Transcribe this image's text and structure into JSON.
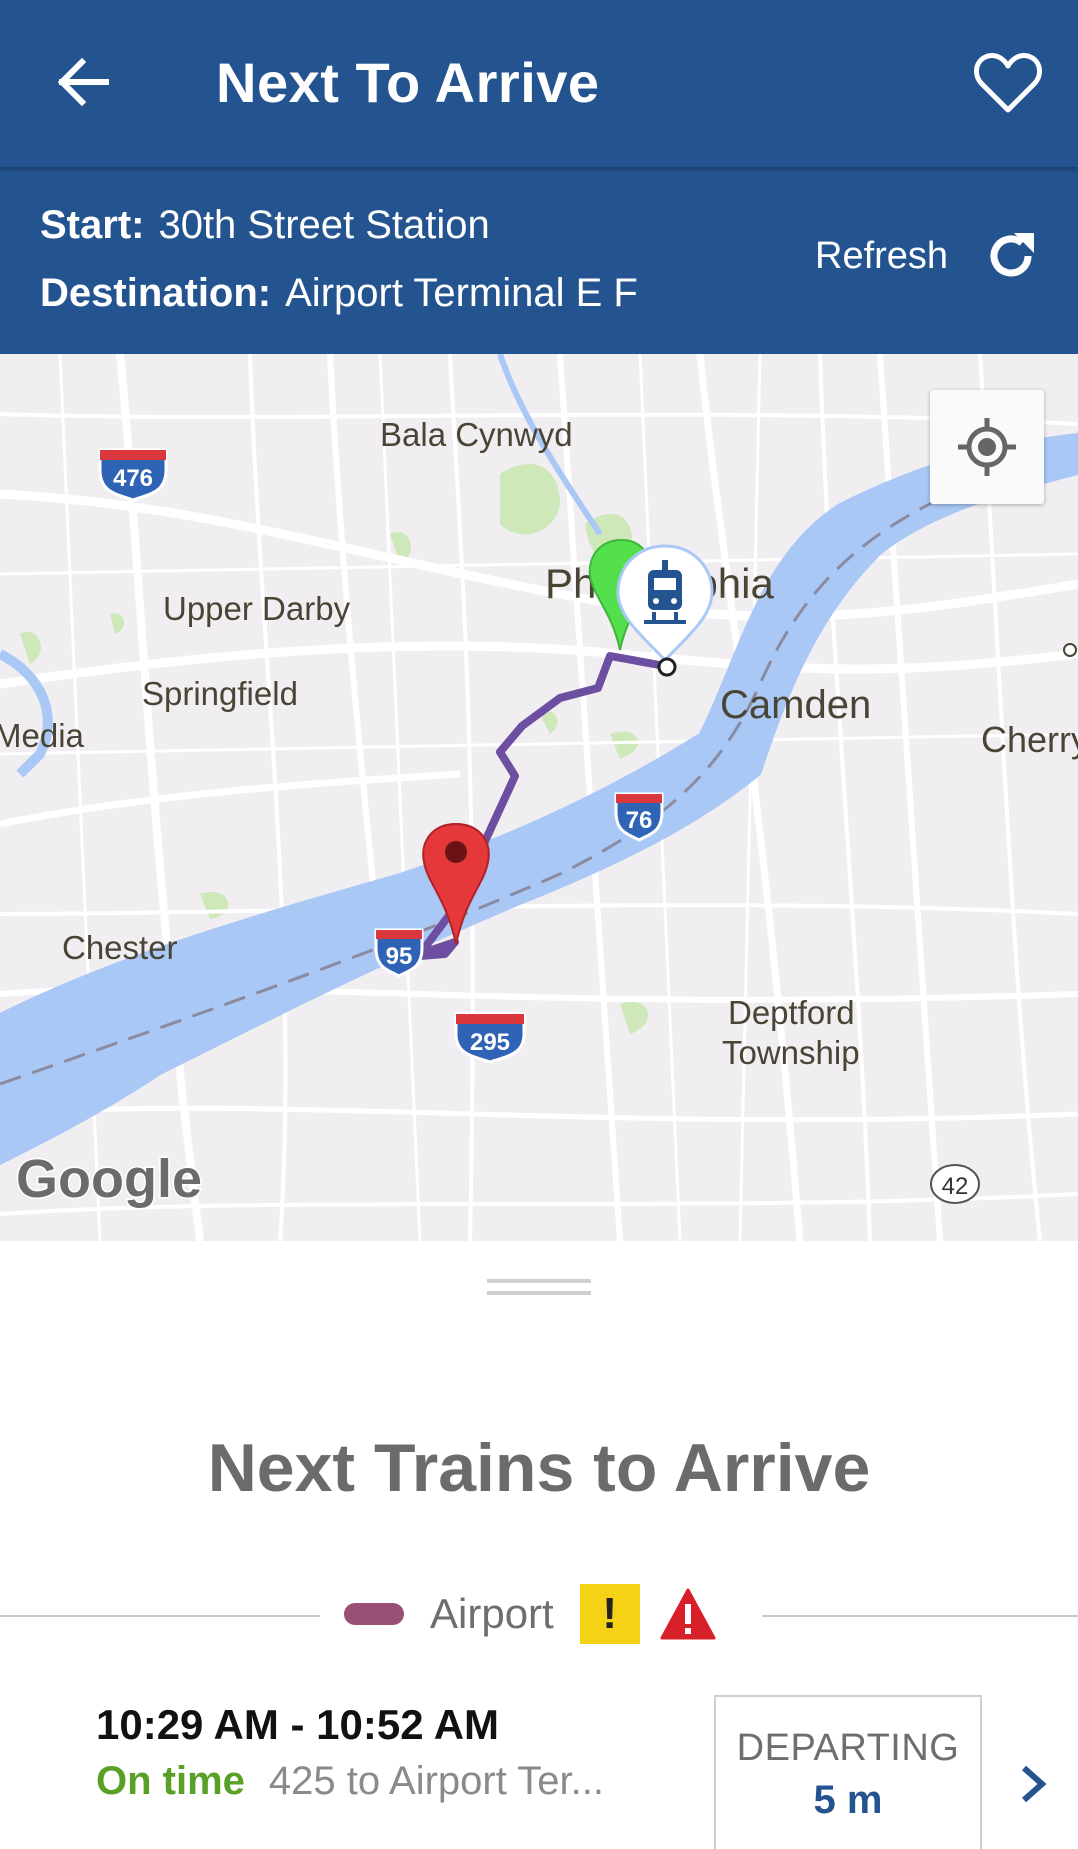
{
  "header": {
    "title": "Next To Arrive"
  },
  "trip": {
    "start_label": "Start:",
    "start_value": "30th Street Station",
    "destination_label": "Destination:",
    "destination_value": "Airport Terminal E F",
    "refresh_label": "Refresh"
  },
  "map": {
    "places": {
      "bala_cynwyd": "Bala Cynwyd",
      "upper_darby": "Upper Darby",
      "springfield": "Springfield",
      "media": "Media",
      "philadelphia": "Philadelphia",
      "camden": "Camden",
      "cherry": "Cherry",
      "chester": "Chester",
      "deptford_1": "Deptford",
      "deptford_2": "Township"
    },
    "shields": {
      "i476": "476",
      "i76": "76",
      "i95": "95",
      "i295": "295",
      "r42": "42"
    },
    "attribution": "Google"
  },
  "sheet": {
    "title": "Next Trains to Arrive",
    "route": {
      "name": "Airport",
      "color": "#9a4f76",
      "advisory": "!"
    },
    "trains": [
      {
        "time": "10:29 AM - 10:52 AM",
        "status": "On time",
        "destination": "425 to Airport Ter...",
        "departing_label": "DEPARTING",
        "departing_value": "5 m"
      }
    ]
  },
  "colors": {
    "primary": "#24548f",
    "on_time": "#59a026",
    "route_airport": "#9a4f76",
    "route_path": "#6d4ea0",
    "advisory": "#f6d216",
    "alert": "#d8202a"
  },
  "icons": {
    "back": "arrow-left-icon",
    "favorite": "heart-outline-icon",
    "refresh": "refresh-icon",
    "locate": "my-location-icon",
    "advisory": "advisory-icon",
    "alert": "alert-triangle-icon",
    "chevron": "chevron-right-icon",
    "trolley": "trolley-icon"
  }
}
